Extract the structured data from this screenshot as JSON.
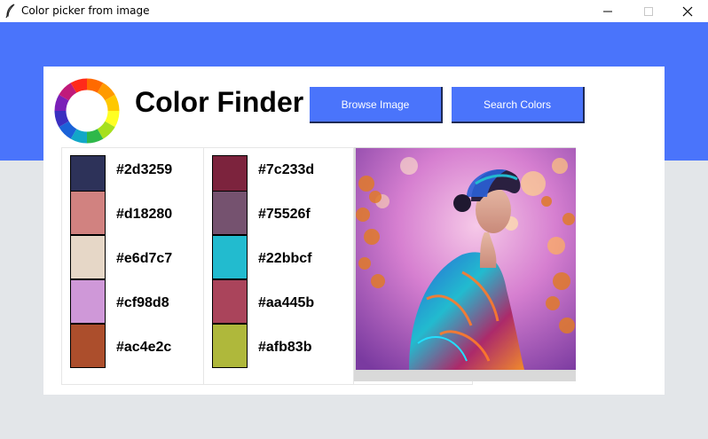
{
  "window": {
    "title": "Color picker from image",
    "controls": [
      "minimize-icon",
      "maximize-icon",
      "close-icon"
    ]
  },
  "app": {
    "title": "Color Finder",
    "logo": "color-wheel-icon"
  },
  "buttons": {
    "browse": "Browse Image",
    "search": "Search Colors"
  },
  "colors": {
    "background_top": "#4a74fb",
    "background_bottom": "#e3e6e9",
    "button": "#4a74fb"
  },
  "palette": {
    "left": [
      {
        "hex": "#2d3259"
      },
      {
        "hex": "#d18280"
      },
      {
        "hex": "#e6d7c7"
      },
      {
        "hex": "#cf98d8"
      },
      {
        "hex": "#ac4e2c"
      }
    ],
    "right": [
      {
        "hex": "#7c233d"
      },
      {
        "hex": "#75526f"
      },
      {
        "hex": "#22bbcf"
      },
      {
        "hex": "#aa445b"
      },
      {
        "hex": "#afb83b"
      }
    ]
  },
  "image": {
    "content": "preview-image"
  }
}
